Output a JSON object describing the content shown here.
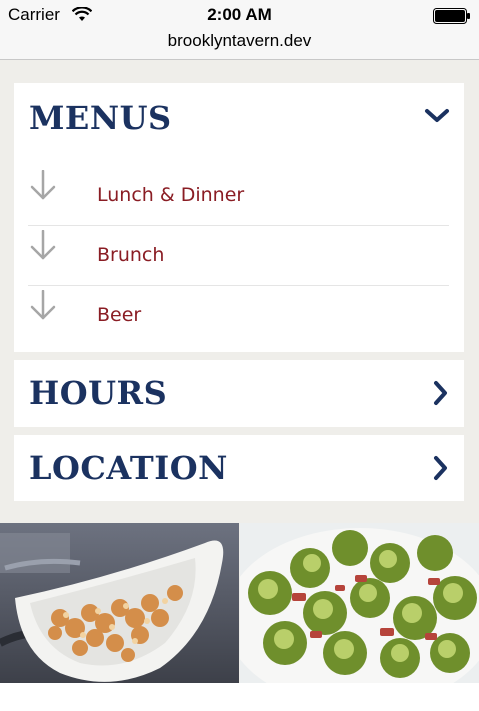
{
  "status_bar": {
    "carrier": "Carrier",
    "time": "2:00 AM"
  },
  "browser": {
    "url": "brooklyntavern.dev"
  },
  "sections": {
    "menus": {
      "title": "MENUS",
      "expanded": true,
      "toggle_icon": "chevron-down-icon",
      "items": [
        {
          "label": "Lunch & Dinner",
          "icon": "arrow-down-icon"
        },
        {
          "label": "Brunch",
          "icon": "arrow-down-icon"
        },
        {
          "label": "Beer",
          "icon": "arrow-down-icon"
        }
      ]
    },
    "hours": {
      "title": "HOURS",
      "expanded": false,
      "toggle_icon": "chevron-right-icon"
    },
    "location": {
      "title": "LOCATION",
      "expanded": false,
      "toggle_icon": "chevron-right-icon"
    }
  },
  "photos": [
    {
      "subject": "popcorn in white bowl"
    },
    {
      "subject": "brussels sprouts with bacon"
    }
  ],
  "colors": {
    "heading": "#1b3260",
    "link": "#8a1d24",
    "arrow": "#a6a6a6",
    "background": "#efeeea"
  }
}
